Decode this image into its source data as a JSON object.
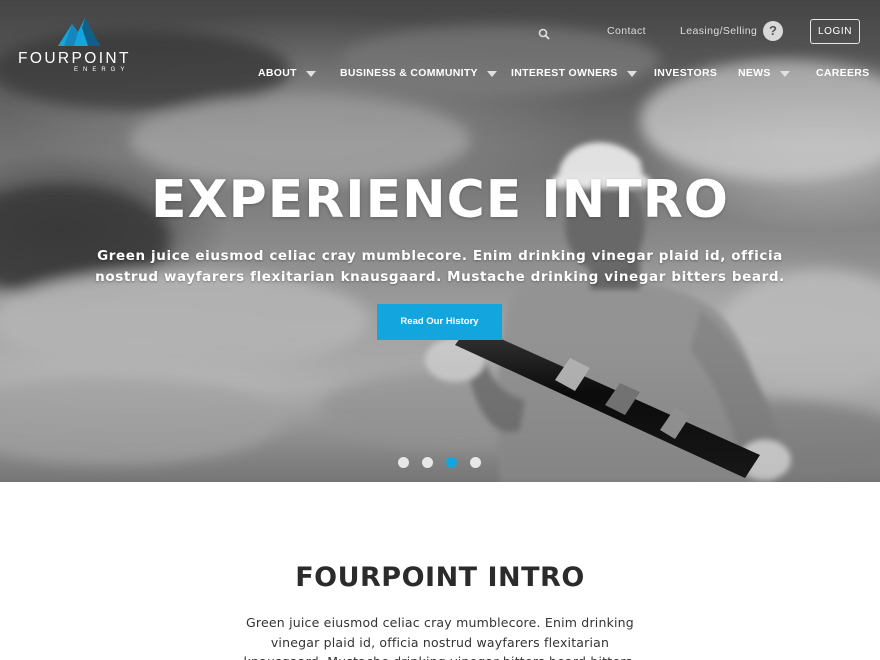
{
  "brand": {
    "name": "FOURPOINT",
    "tagline": "ENERGY",
    "logo_icon": "mountain-peaks-icon",
    "accent_color": "#13a6de",
    "accent_dark": "#0f5f86"
  },
  "utility_bar": {
    "search_icon": "search-icon",
    "contact_label": "Contact",
    "leasing_label": "Leasing/Selling",
    "help_label": "?",
    "login_label": "LOGIN"
  },
  "nav": {
    "items": [
      {
        "label": "ABOUT",
        "has_dropdown": true
      },
      {
        "label": "BUSINESS & COMMUNITY",
        "has_dropdown": true
      },
      {
        "label": "INTEREST OWNERS",
        "has_dropdown": true
      },
      {
        "label": "INVESTORS",
        "has_dropdown": false
      },
      {
        "label": "NEWS",
        "has_dropdown": true
      },
      {
        "label": "CAREERS",
        "has_dropdown": false
      }
    ]
  },
  "hero": {
    "title": "EXPERIENCE INTRO",
    "subtitle": "Green juice eiusmod celiac cray mumblecore. Enim drinking vinegar plaid id, officia nostrud wayfarers flexitarian knausgaard. Mustache drinking vinegar bitters beard.",
    "cta_label": "Read Our History",
    "slides_total": 4,
    "active_slide": 3
  },
  "intro": {
    "title": "FOURPOINT INTRO",
    "body": "Green juice eiusmod celiac cray mumblecore. Enim drinking vinegar plaid id, officia nostrud wayfarers flexitarian knausgaard. Mustache drinking vinegar bitters beard bitters."
  }
}
